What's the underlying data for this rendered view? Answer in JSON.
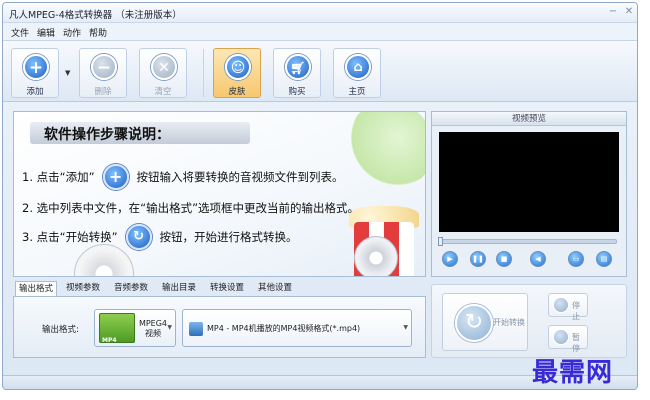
{
  "window": {
    "title": "凡人MPEG-4格式转换器 （未注册版本）",
    "minimize_icon": "minimize-icon",
    "close_icon": "close-icon"
  },
  "menu": [
    "文件",
    "编辑",
    "动作",
    "帮助"
  ],
  "toolbar": {
    "add": {
      "label": "添加",
      "icon": "add-icon"
    },
    "delete": {
      "label": "删除",
      "icon": "minus-icon"
    },
    "clear": {
      "label": "清空",
      "icon": "clear-icon"
    },
    "skin": {
      "label": "皮肤",
      "icon": "smiley-icon"
    },
    "buy": {
      "label": "购买",
      "icon": "cart-icon"
    },
    "home": {
      "label": "主页",
      "icon": "home-icon"
    }
  },
  "banner": {
    "title": "软件操作步骤说明：",
    "step1_a": "1. 点击“添加”",
    "step1_b": "按钮输入将要转换的音视频文件到列表。",
    "step2": "2. 选中列表中文件，在“输出格式”选项框中更改当前的输出格式。",
    "step3_a": "3. 点击“开始转换”",
    "step3_b": "按钮，开始进行格式转换。"
  },
  "preview": {
    "title": "视频预览",
    "controls": [
      "play-icon",
      "pause-icon",
      "stop-icon",
      "volume-icon",
      "snapshot-icon",
      "folder-icon"
    ]
  },
  "tabs": [
    "输出格式",
    "视频参数",
    "音频参数",
    "输出目录",
    "转换设置",
    "其他设置"
  ],
  "format": {
    "label": "输出格式:",
    "type_text": "MPEG4视频",
    "type_icon_text": "MP4",
    "selected": "MP4 - MP4机播放的MP4视频格式(*.mp4)"
  },
  "convert": {
    "start_label": "开始转换",
    "stop_label": "停止",
    "pause_label": "暂停"
  },
  "watermark": "最需网",
  "colors": {
    "accent": "#2a6fcf",
    "highlight": "#f7c770",
    "watermark": "#3a2ad6"
  }
}
